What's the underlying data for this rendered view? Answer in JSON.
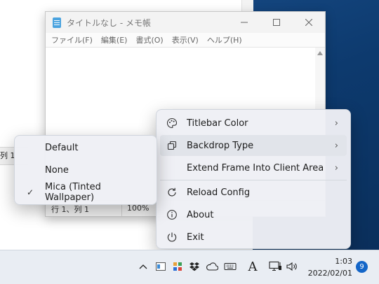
{
  "notepad": {
    "title": "タイトルなし - メモ帳",
    "menu": [
      "ファイル(F)",
      "編集(E)",
      "書式(O)",
      "表示(V)",
      "ヘルプ(H)"
    ],
    "status": {
      "position": "行 1、列 1",
      "zoom": "100%"
    }
  },
  "background_window": {
    "status_text": "列 1"
  },
  "context_menu": {
    "items": [
      {
        "label": "Titlebar Color",
        "icon": "palette-icon",
        "has_submenu": true
      },
      {
        "label": "Backdrop Type",
        "icon": "copy-icon",
        "has_submenu": true,
        "highlighted": true
      },
      {
        "label": "Extend Frame Into Client Area",
        "icon": "",
        "has_submenu": true
      },
      {
        "label": "Reload Config",
        "icon": "refresh-icon",
        "has_submenu": false
      },
      {
        "label": "About",
        "icon": "info-icon",
        "has_submenu": false
      },
      {
        "label": "Exit",
        "icon": "power-icon",
        "has_submenu": false
      }
    ],
    "chevron": "›"
  },
  "submenu": {
    "items": [
      {
        "label": "Default",
        "checked": false
      },
      {
        "label": "None",
        "checked": false
      },
      {
        "label": "Mica (Tinted Wallpaper)",
        "checked": true
      }
    ],
    "check_glyph": "✓"
  },
  "taskbar": {
    "time": "1:03",
    "date": "2022/02/01",
    "notification_count": "9",
    "ime_label": "A",
    "tray_icons": [
      "chevron-up-icon",
      "app-icon",
      "palette-app-icon",
      "dropbox-icon",
      "onedrive-icon",
      "keyboard-icon",
      "ime-icon",
      "network-icon",
      "volume-icon"
    ]
  },
  "colors": {
    "accent": "#1466c8",
    "menu_bg": "#eef0f5",
    "highlight": "#e1e4ea",
    "desktop": "#0d3a6e"
  }
}
